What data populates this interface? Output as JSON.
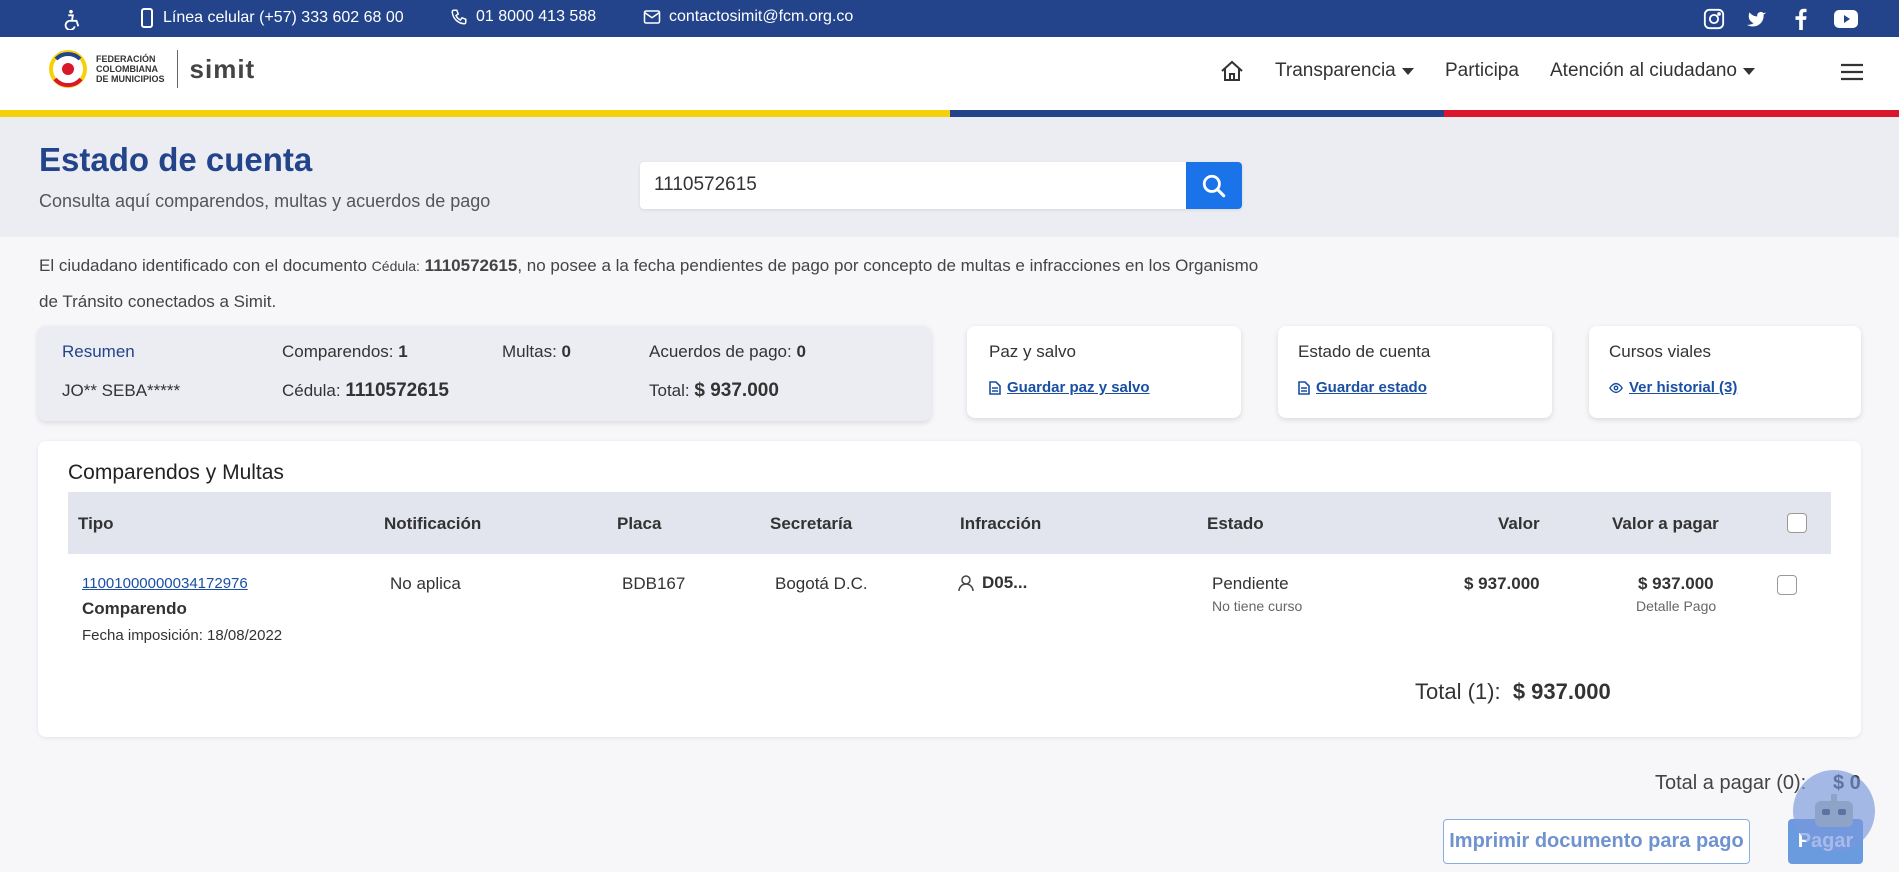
{
  "topbar": {
    "phone_mobile": "Línea celular (+57) 333 602 68 00",
    "phone_landline": "01 8000 413 588",
    "email": "contactosimit@fcm.org.co",
    "social": [
      "instagram-icon",
      "twitter-icon",
      "facebook-icon",
      "youtube-icon"
    ]
  },
  "header": {
    "logo_fcm": [
      "FEDERACIÓN",
      "COLOMBIANA",
      "DE MUNICIPIOS"
    ],
    "logo_simit": "simit",
    "nav": {
      "transparencia": "Transparencia",
      "participa": "Participa",
      "atencion": "Atención al ciudadano"
    }
  },
  "hero": {
    "title": "Estado de cuenta",
    "subtitle": "Consulta aquí comparendos, multas y acuerdos de pago",
    "search_value": "1110572615"
  },
  "notice": {
    "part1": "El ciudadano identificado con el documento ",
    "doc_type": "Cédula:",
    "doc_number": "1110572615",
    "part2": ", no posee a la fecha pendientes de pago por concepto de multas e infracciones en los Organismo de Tránsito conectados a Simit."
  },
  "summary": {
    "title": "Resumen",
    "name": "JO** SEBA*****",
    "comparendos_label": "Comparendos:",
    "comparendos_value": "1",
    "multas_label": "Multas:",
    "multas_value": "0",
    "acuerdos_label": "Acuerdos de pago:",
    "acuerdos_value": "0",
    "cedula_label": "Cédula:",
    "cedula_value": "1110572615",
    "total_label": "Total:",
    "total_value": "$ 937.000"
  },
  "cards": {
    "paz": {
      "title": "Paz y salvo",
      "link": "Guardar paz y salvo"
    },
    "estado": {
      "title": "Estado de cuenta",
      "link": "Guardar estado"
    },
    "cursos": {
      "title": "Cursos viales",
      "link": "Ver historial (3)"
    }
  },
  "table": {
    "title": "Comparendos y Multas",
    "headers": {
      "tipo": "Tipo",
      "notificacion": "Notificación",
      "placa": "Placa",
      "secretaria": "Secretaría",
      "infraccion": "Infracción",
      "estado": "Estado",
      "valor": "Valor",
      "valor_pagar": "Valor a pagar"
    },
    "rows": [
      {
        "numero": "11001000000034172976",
        "tipo": "Comparendo",
        "fecha": "Fecha imposición: 18/08/2022",
        "notificacion": "No aplica",
        "placa": "BDB167",
        "secretaria": "Bogotá D.C.",
        "infraccion": "D05...",
        "estado": "Pendiente",
        "curso": "No tiene curso",
        "valor": "$ 937.000",
        "valor_pagar": "$ 937.000",
        "detalle": "Detalle Pago"
      }
    ],
    "total_label": "Total (1):",
    "total_value": "$ 937.000"
  },
  "footer": {
    "total_pagar_label": "Total a pagar (0):",
    "total_pagar_value": "$ 0",
    "print_button": "Imprimir documento para pago",
    "pay_button": "Pagar"
  },
  "colors": {
    "brand_blue": "#23448b",
    "accent_blue": "#1a73e8",
    "stripe_yellow": "#f5d10a",
    "stripe_blue": "#23448b",
    "stripe_red": "#d9162b"
  }
}
